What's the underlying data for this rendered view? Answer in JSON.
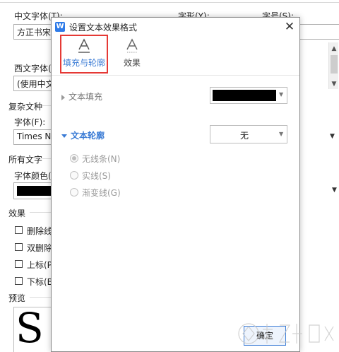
{
  "background_dialog": {
    "chinese_font_label": "中文字体(T):",
    "chinese_font_value": "方正书宋",
    "style_label": "字形(Y):",
    "size_label": "字号(S):",
    "western_font_label": "西文字体(",
    "western_font_value": "(使用中文",
    "complex_script_label": "复杂文种",
    "font_label": "字体(F):",
    "font_value": "Times N",
    "all_text_label": "所有文字",
    "font_color_label": "字体颜色(",
    "effects_label": "效果",
    "checkboxes": [
      "删除线",
      "双删除",
      "上标(P",
      "下标(B"
    ],
    "preview_label": "预览",
    "preview_glyph": "S"
  },
  "dialog": {
    "title": "设置文本效果格式",
    "logo_letter": "W",
    "close_symbol": "✕",
    "tabs": [
      {
        "label": "填充与轮廓",
        "icon": "text-fill-icon",
        "selected": true
      },
      {
        "label": "效果",
        "icon": "text-effect-icon",
        "selected": false
      }
    ],
    "text_fill": {
      "label": "文本填充",
      "color": "#000000"
    },
    "text_outline": {
      "label": "文本轮廓",
      "value": "无",
      "options": [
        {
          "label": "无线条(N)",
          "selected": true
        },
        {
          "label": "实线(S)",
          "selected": false
        },
        {
          "label": "渐变线(G)",
          "selected": false
        }
      ]
    },
    "ok_label": "确定"
  },
  "colors": {
    "accent": "#3a7bd5",
    "highlight_frame": "#e53935",
    "disabled_text": "#9a9a9a"
  }
}
